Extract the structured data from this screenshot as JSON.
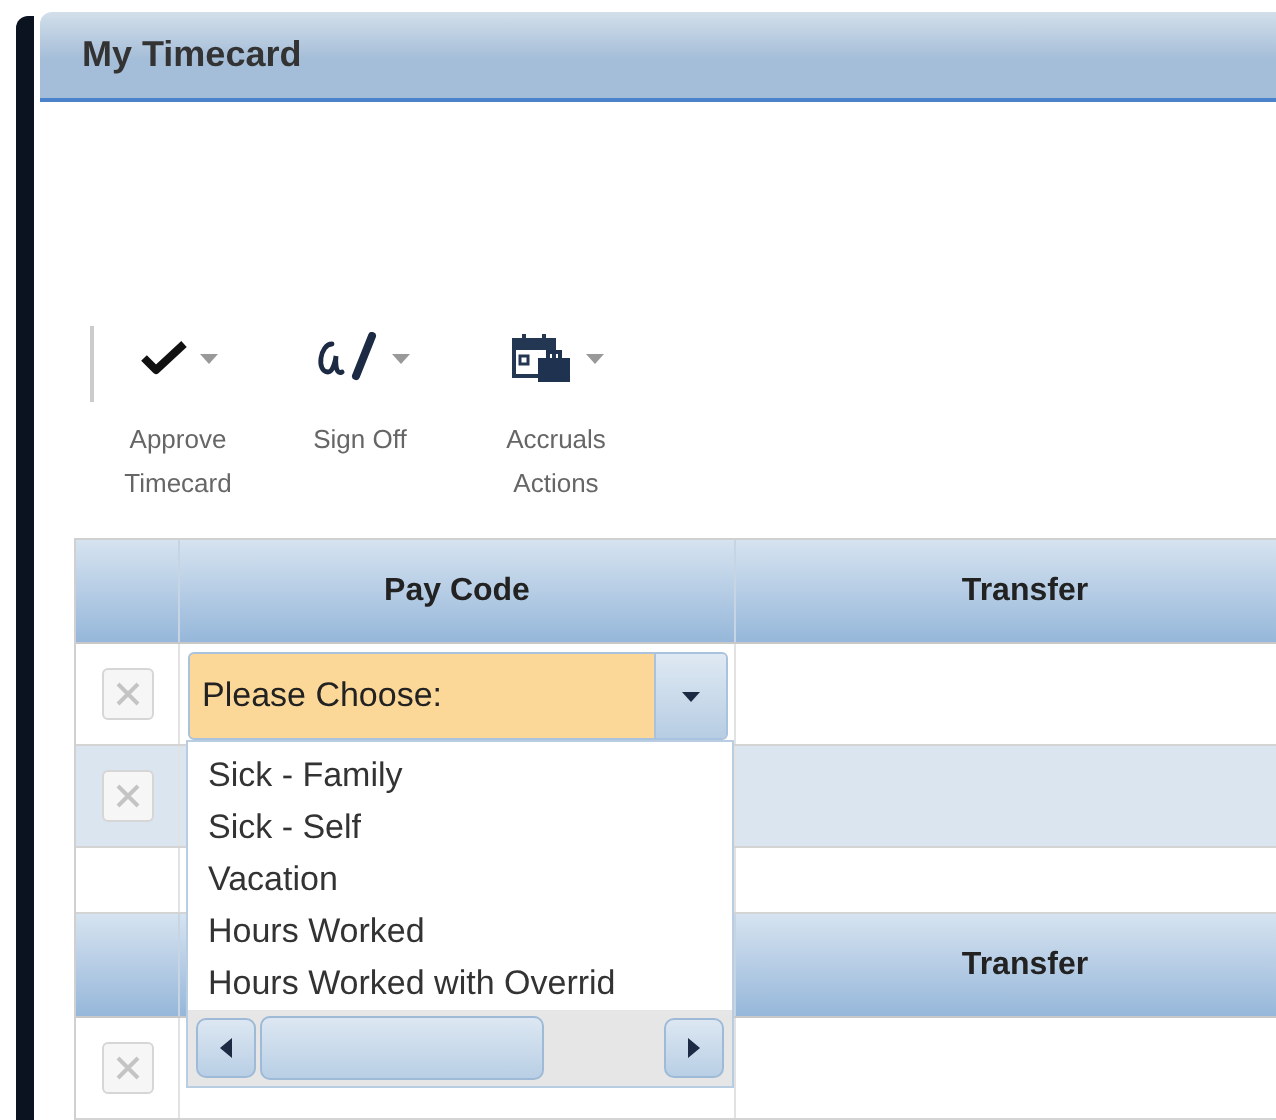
{
  "panel": {
    "title": "My Timecard"
  },
  "toolbar": [
    {
      "label": "Approve\nTimecard"
    },
    {
      "label": "Sign Off"
    },
    {
      "label": "Accruals\nActions"
    }
  ],
  "sections": [
    {
      "columns": [
        {
          "label": "Pay Code"
        },
        {
          "label": "Transfer"
        }
      ],
      "rows": [
        {
          "shaded": false,
          "kind": "dropdown"
        },
        {
          "shaded": true,
          "kind": "plain"
        },
        {
          "shaded": false,
          "kind": "spacer"
        }
      ]
    },
    {
      "columns": [
        {},
        {
          "label": "Transfer"
        }
      ],
      "rows": [
        {
          "shaded": false,
          "kind": "plain"
        }
      ]
    }
  ],
  "pay_code_dropdown": {
    "value": "Please Choose:",
    "open": true,
    "options": [
      "Sick - Family",
      "Sick - Self",
      "Vacation",
      "Hours Worked",
      "Hours Worked with Overrid"
    ]
  }
}
